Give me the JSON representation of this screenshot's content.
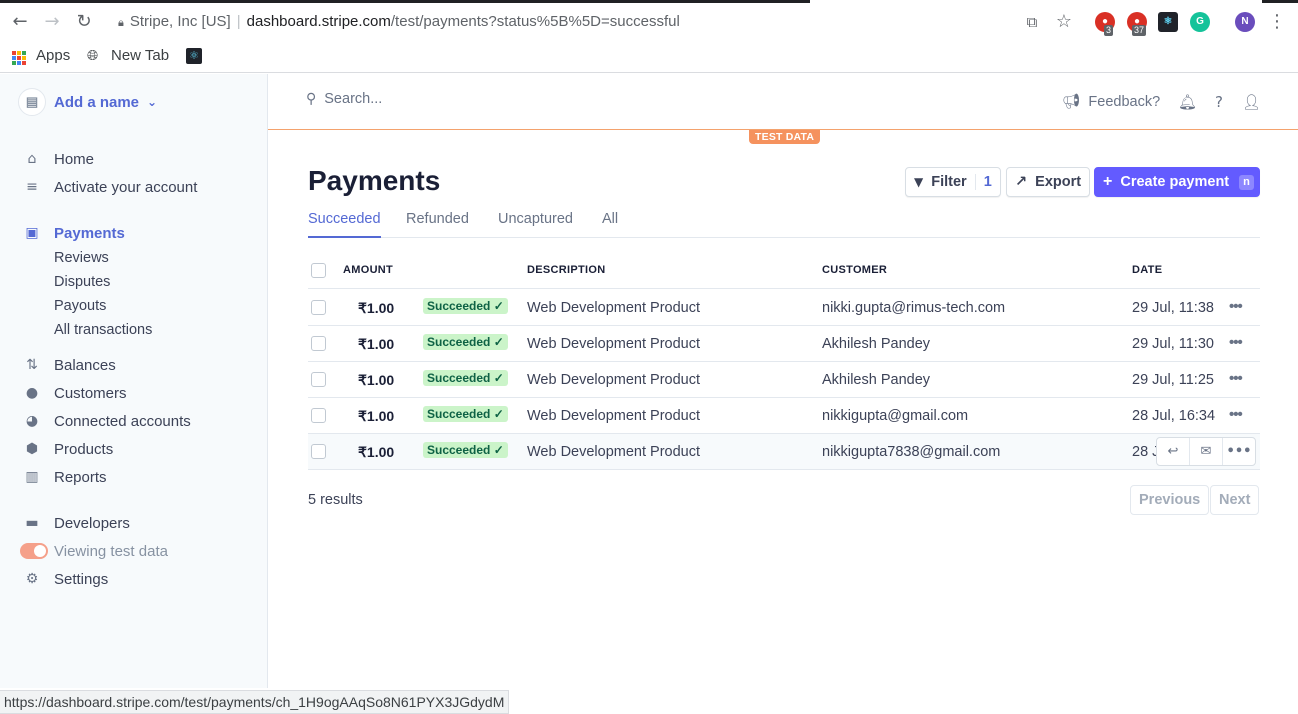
{
  "browser": {
    "site_name": "Stripe, Inc [US]",
    "url_host": "dashboard.stripe.com",
    "url_path": "/test/payments?status%5B%5D=successful",
    "ext_badge_1": "3",
    "ext_badge_2": "37",
    "profile_initial": "N",
    "bookmarks": {
      "apps": "Apps",
      "new_tab": "New Tab"
    },
    "status_url": "https://dashboard.stripe.com/test/payments/ch_1H9ogAAqSo8N61PYX3JGdydM"
  },
  "sidebar": {
    "account_name": "Add a name",
    "items": {
      "home": "Home",
      "activate": "Activate your account",
      "payments": "Payments",
      "reviews": "Reviews",
      "disputes": "Disputes",
      "payouts": "Payouts",
      "all_transactions": "All transactions",
      "balances": "Balances",
      "customers": "Customers",
      "connected": "Connected accounts",
      "products": "Products",
      "reports": "Reports",
      "developers": "Developers",
      "test_data": "Viewing test data",
      "settings": "Settings"
    }
  },
  "header": {
    "search_placeholder": "Search...",
    "feedback": "Feedback?",
    "test_data_badge": "TEST DATA"
  },
  "page": {
    "title": "Payments",
    "filter_label": "Filter",
    "filter_count": "1",
    "export_label": "Export",
    "create_label": "Create payment",
    "create_shortcut": "n",
    "tabs": {
      "succeeded": "Succeeded",
      "refunded": "Refunded",
      "uncaptured": "Uncaptured",
      "all": "All"
    }
  },
  "table": {
    "headers": {
      "amount": "AMOUNT",
      "description": "DESCRIPTION",
      "customer": "CUSTOMER",
      "date": "DATE"
    },
    "rows": [
      {
        "amount": "₹1.00",
        "status": "Succeeded ✓",
        "description": "Web Development Product",
        "customer": "nikki.gupta@rimus-tech.com",
        "date": "29 Jul, 11:38"
      },
      {
        "amount": "₹1.00",
        "status": "Succeeded ✓",
        "description": "Web Development Product",
        "customer": "Akhilesh Pandey",
        "date": "29 Jul, 11:30"
      },
      {
        "amount": "₹1.00",
        "status": "Succeeded ✓",
        "description": "Web Development Product",
        "customer": "Akhilesh Pandey",
        "date": "29 Jul, 11:25"
      },
      {
        "amount": "₹1.00",
        "status": "Succeeded ✓",
        "description": "Web Development Product",
        "customer": "nikkigupta@gmail.com",
        "date": "28 Jul, 16:34"
      },
      {
        "amount": "₹1.00",
        "status": "Succeeded ✓",
        "description": "Web Development Product",
        "customer": "nikkigupta7838@gmail.com",
        "date": "28 J"
      }
    ]
  },
  "footer": {
    "results": "5 results",
    "previous": "Previous",
    "next": "Next"
  },
  "colors": {
    "accent": "#5469d4",
    "primary_button": "#635bff",
    "test_badge": "#f5925e",
    "success_bg": "#cbf4c9"
  }
}
